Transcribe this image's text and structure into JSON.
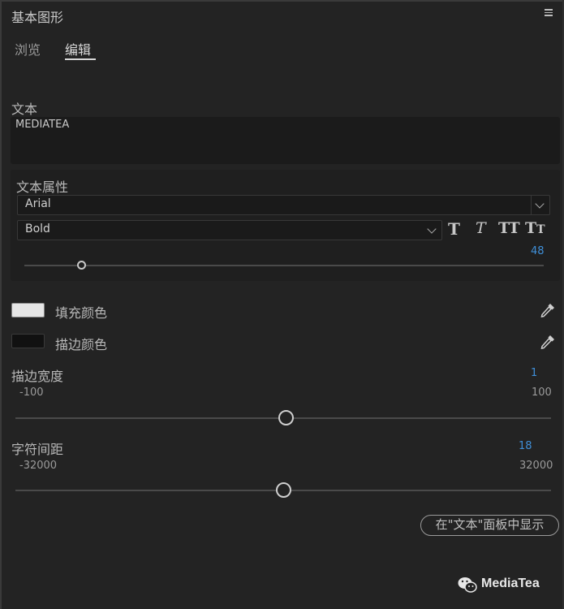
{
  "panel": {
    "title": "基本图形"
  },
  "tabs": [
    {
      "label": "浏览",
      "active": false
    },
    {
      "label": "编辑",
      "active": true
    }
  ],
  "text_section": {
    "label": "文本",
    "value": "MEDIATEA"
  },
  "text_properties": {
    "label": "文本属性",
    "font_family": "Arial",
    "font_style": "Bold",
    "font_size": "48",
    "font_size_fraction": 0.11,
    "style_buttons": [
      {
        "name": "faux-bold",
        "glyph": "T"
      },
      {
        "name": "faux-italic",
        "glyph": "T"
      },
      {
        "name": "all-caps",
        "glyph": "TT"
      },
      {
        "name": "small-caps",
        "glyph": "TT"
      }
    ]
  },
  "fill": {
    "label": "填充颜色",
    "color": "#e6e6e6"
  },
  "stroke": {
    "label": "描边颜色",
    "color": "#111111"
  },
  "stroke_width": {
    "label": "描边宽度",
    "value": "1",
    "min": "-100",
    "max": "100",
    "fraction": 0.505
  },
  "tracking": {
    "label": "字符间距",
    "value": "18",
    "min": "-32000",
    "max": "32000",
    "fraction": 0.5003
  },
  "show_in_text_panel_button": {
    "label": "在\"文本\"面板中显示"
  },
  "watermark": {
    "text": "MediaTea"
  },
  "colors": {
    "accent_blue": "#3f8fd8",
    "panel_bg": "#232323"
  }
}
